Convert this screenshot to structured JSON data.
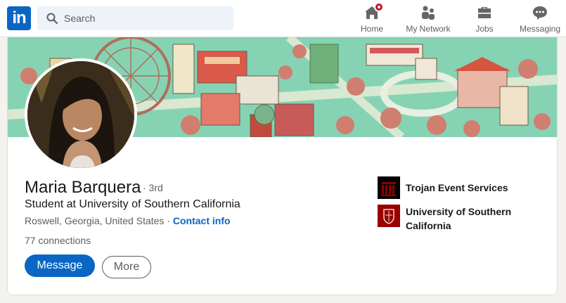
{
  "nav": {
    "logo_text": "in",
    "search_placeholder": "Search",
    "items": [
      {
        "label": "Home",
        "icon": "home-icon",
        "has_badge": true
      },
      {
        "label": "My Network",
        "icon": "network-icon"
      },
      {
        "label": "Jobs",
        "icon": "briefcase-icon"
      },
      {
        "label": "Messaging",
        "icon": "messaging-icon"
      }
    ]
  },
  "profile": {
    "name": "Maria Barquera",
    "degree": "· 3rd",
    "headline": "Student at University of Southern California",
    "location": "Roswell, Georgia, United States",
    "separator": "·",
    "contact_label": "Contact info",
    "connections": "77 connections",
    "message_label": "Message",
    "more_label": "More"
  },
  "orgs": [
    {
      "name": "Trojan Event Services",
      "logo": "trojan-event-services-logo"
    },
    {
      "name": "University of Southern California",
      "logo": "usc-seal-logo"
    }
  ],
  "colors": {
    "accent": "#0a66c2",
    "badge": "#cb112d",
    "usc_cardinal": "#990000"
  }
}
